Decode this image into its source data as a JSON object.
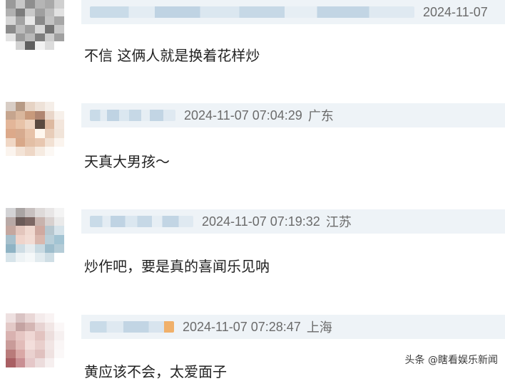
{
  "comments": [
    {
      "timestamp": "2024-11-07",
      "location": "",
      "text": "不信 这俩人就是换着花样炒"
    },
    {
      "timestamp": "2024-11-07 07:04:29",
      "location": "广东",
      "text": "天真大男孩～"
    },
    {
      "timestamp": "2024-11-07 07:19:32",
      "location": "江苏",
      "text": "炒作吧，要是真的喜闻乐见呐"
    },
    {
      "timestamp": "2024-11-07 07:28:47",
      "location": "上海",
      "text": "黄应该不会，太爱面子"
    }
  ],
  "watermark": "头条 @瞎看娱乐新闻",
  "colors": {
    "meta_bar": "#eef3f7",
    "timestamp": "#6b6b6b",
    "text": "#222222"
  }
}
